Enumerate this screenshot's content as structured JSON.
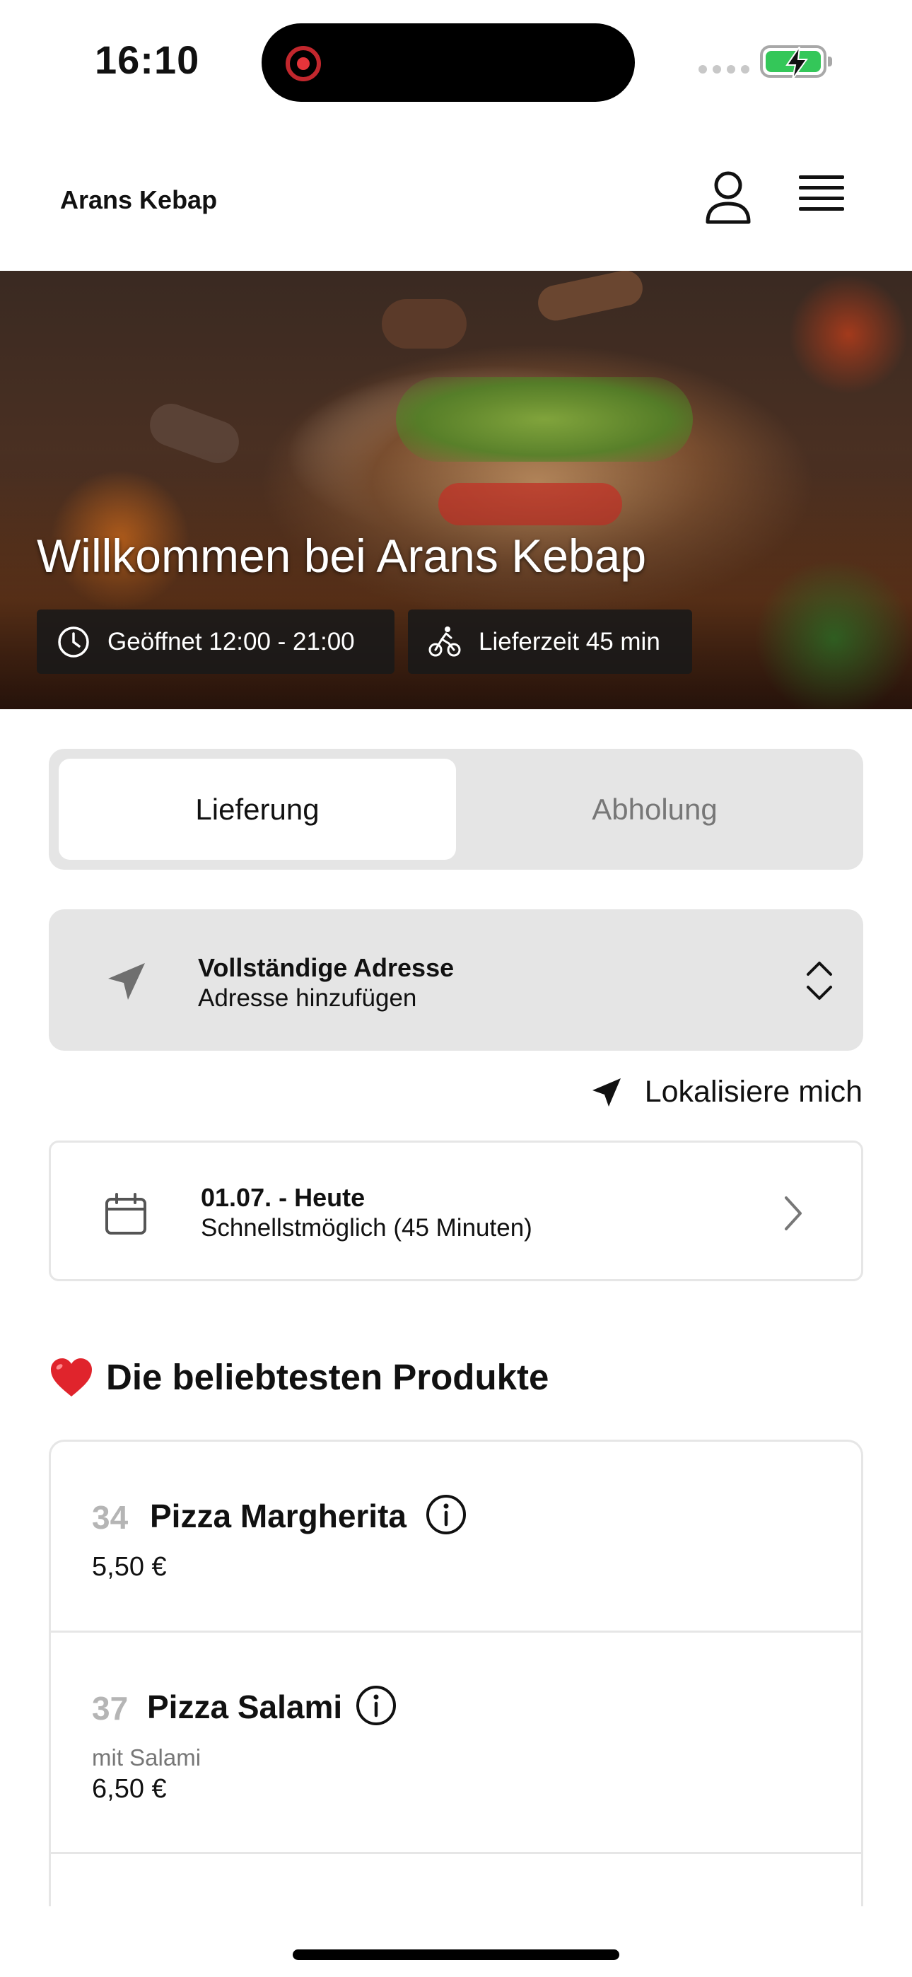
{
  "status_bar": {
    "time": "16:10"
  },
  "header": {
    "brand": "Arans Kebap"
  },
  "hero": {
    "title": "Willkommen bei Arans Kebap",
    "opening_hours": "Geöffnet 12:00 - 21:00",
    "delivery_time": "Lieferzeit 45 min"
  },
  "order_mode": {
    "tabs": [
      {
        "label": "Lieferung",
        "active": true
      },
      {
        "label": "Abholung",
        "active": false
      }
    ]
  },
  "address": {
    "title": "Vollständige Adresse",
    "subtitle": "Adresse hinzufügen",
    "locate_label": "Lokalisiere mich"
  },
  "schedule": {
    "date": "01.07. - Heute",
    "time": "Schnellstmöglich (45 Minuten)"
  },
  "popular": {
    "heading": "Die beliebtesten Produkte",
    "products": [
      {
        "number": "34",
        "name": "Pizza Margherita",
        "description": "",
        "price": "5,50 €"
      },
      {
        "number": "37",
        "name": "Pizza Salami",
        "description": "mit Salami",
        "price": "6,50 €"
      }
    ]
  },
  "colors": {
    "battery": "#34c759",
    "recording": "#e5343a",
    "heart": "#e0242c",
    "panel_bg": "#e5e5e5"
  },
  "icons": [
    "clock-icon",
    "bicycle-icon",
    "user-icon",
    "hamburger-menu-icon",
    "navigation-arrow-icon",
    "chevron-up-down-icon",
    "calendar-icon",
    "chevron-right-icon",
    "heart-icon",
    "info-icon"
  ]
}
